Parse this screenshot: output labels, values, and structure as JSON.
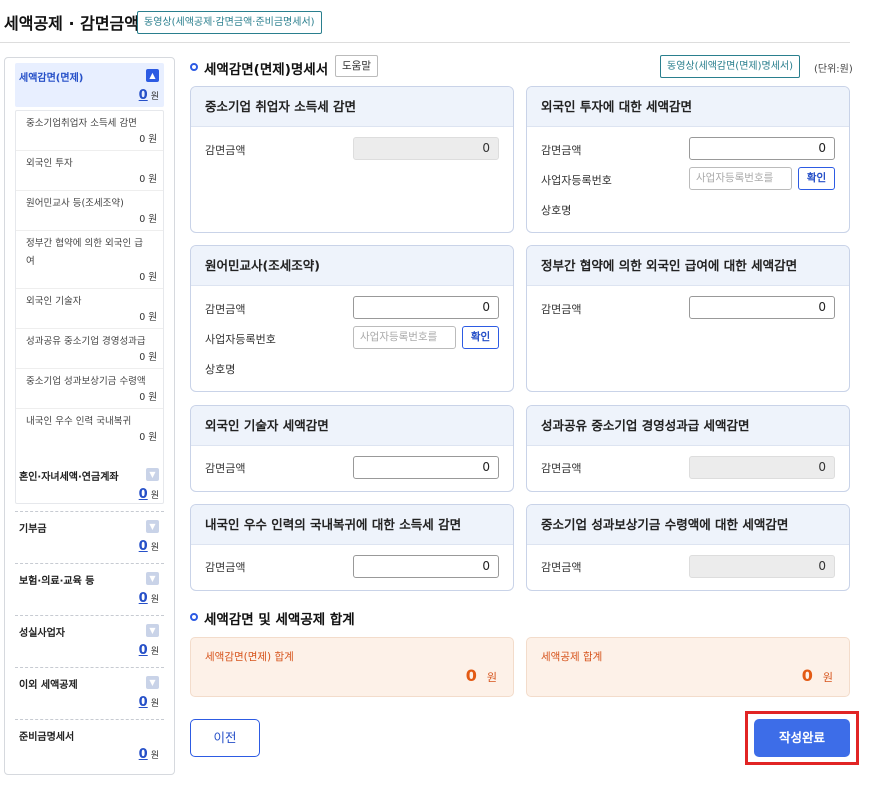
{
  "header": {
    "title": "세액공제 · 감면금액",
    "video_button": "동영상(세액공제·감면금액·준비금명세서)"
  },
  "sidebar": {
    "active": {
      "label": "세액감면(면제)",
      "amount": "0",
      "unit": "원"
    },
    "sub_items": [
      {
        "label": "중소기업취업자 소득세 감면",
        "amount": "0 원"
      },
      {
        "label": "외국인 투자",
        "amount": "0 원"
      },
      {
        "label": "원어민교사 등(조세조약)",
        "amount": "0 원"
      },
      {
        "label": "정부간 협약에 의한 외국인 급여",
        "amount": "0 원"
      },
      {
        "label": "외국인 기술자",
        "amount": "0 원"
      },
      {
        "label": "성과공유 중소기업 경영성과급",
        "amount": "0 원"
      },
      {
        "label": "중소기업 성과보상기금 수령액",
        "amount": "0 원"
      },
      {
        "label": "내국인 우수 인력 국내복귀",
        "amount": "0 원"
      }
    ],
    "groups": [
      {
        "label": "혼인·자녀세액·연금계좌",
        "amount": "0",
        "unit": "원"
      },
      {
        "label": "기부금",
        "amount": "0",
        "unit": "원"
      },
      {
        "label": "보험·의료·교육 등",
        "amount": "0",
        "unit": "원"
      },
      {
        "label": "성실사업자",
        "amount": "0",
        "unit": "원"
      },
      {
        "label": "이외 세액공제",
        "amount": "0",
        "unit": "원"
      },
      {
        "label": "준비금명세서",
        "amount": "0",
        "unit": "원"
      }
    ]
  },
  "main": {
    "section_title": "세액감면(면제)명세서",
    "help_button": "도움말",
    "video_button": "동영상(세액감면(면제)명세서)",
    "unit_note": "(단위:원)",
    "labels": {
      "amount": "감면금액",
      "reg_no": "사업자등록번호",
      "company": "상호명",
      "reg_placeholder": "사업자등록번호를",
      "confirm": "확인"
    },
    "cards": [
      {
        "title": "중소기업 취업자 소득세 감면",
        "amount": "0"
      },
      {
        "title": "외국인 투자에 대한 세액감면",
        "amount": "0"
      },
      {
        "title": "원어민교사(조세조약)",
        "amount": "0"
      },
      {
        "title": "정부간 협약에 의한 외국인 급여에 대한 세액감면",
        "amount": "0"
      },
      {
        "title": "외국인 기술자 세액감면",
        "amount": "0"
      },
      {
        "title": "성과공유 중소기업 경영성과급 세액감면",
        "amount": "0"
      },
      {
        "title": "내국인 우수 인력의 국내복귀에 대한 소득세 감면",
        "amount": "0"
      },
      {
        "title": "중소기업 성과보상기금 수령액에 대한  세액감면",
        "amount": "0"
      }
    ],
    "totals_title": "세액감면 및 세액공제 합계",
    "totals": [
      {
        "label": "세액감면(면제) 합계",
        "amount": "0",
        "unit": "원"
      },
      {
        "label": "세액공제 합계",
        "amount": "0",
        "unit": "원"
      }
    ],
    "prev_button": "이전",
    "done_button": "작성완료"
  },
  "colors": {
    "accent": "#2d5be3",
    "highlight_frame": "#e12424",
    "total_text": "#e35a14"
  }
}
